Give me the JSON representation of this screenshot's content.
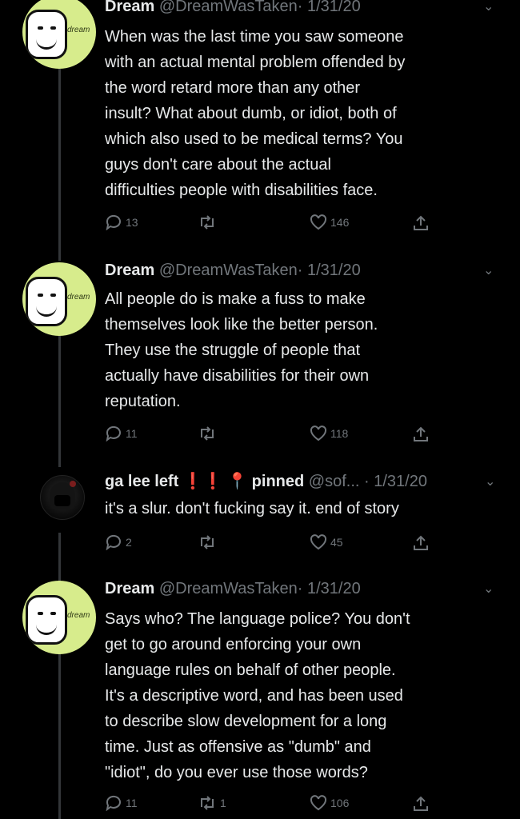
{
  "tweets": [
    {
      "name": "Dream",
      "handle": "@DreamWasTaken",
      "date": "· 1/31/20",
      "avatar_label": "dream",
      "text_lines": [
        "When was the last time you saw someone",
        "with an actual mental problem offended by",
        "the word retard more than any other",
        "insult? What about dumb, or idiot, both of",
        "which also used to be medical terms? You",
        "guys don't care about the actual",
        "difficulties people with disabilities face."
      ],
      "replies": "13",
      "retweets": "",
      "likes": "146"
    },
    {
      "name": "Dream",
      "handle": "@DreamWasTaken",
      "date": "· 1/31/20",
      "avatar_label": "dream",
      "text_lines": [
        "All people do is make a fuss to make",
        "themselves look like the better person.",
        "They use the struggle of people that",
        "actually have disabilities for their own",
        "reputation."
      ],
      "replies": "11",
      "retweets": "",
      "likes": "118"
    },
    {
      "name": "ga lee left",
      "name_suffix": "❗❗",
      "name_pin": "📍",
      "name_extra": "pinned",
      "handle": "@sof...",
      "date": "· 1/31/20",
      "text_lines": [
        "it's a slur. don't fucking say it. end of story"
      ],
      "replies": "2",
      "retweets": "",
      "likes": "45"
    },
    {
      "name": "Dream",
      "handle": "@DreamWasTaken",
      "date": "· 1/31/20",
      "avatar_label": "dream",
      "text_lines": [
        "Says who? The language police? You don't",
        "get to go around enforcing your own",
        "language rules on behalf of other people.",
        "It's a descriptive word, and has been used",
        "to describe slow development for a long",
        "time. Just as offensive as \"dumb\" and",
        "\"idiot\", do you ever use those words?"
      ],
      "replies": "11",
      "retweets": "1",
      "likes": "106"
    }
  ]
}
